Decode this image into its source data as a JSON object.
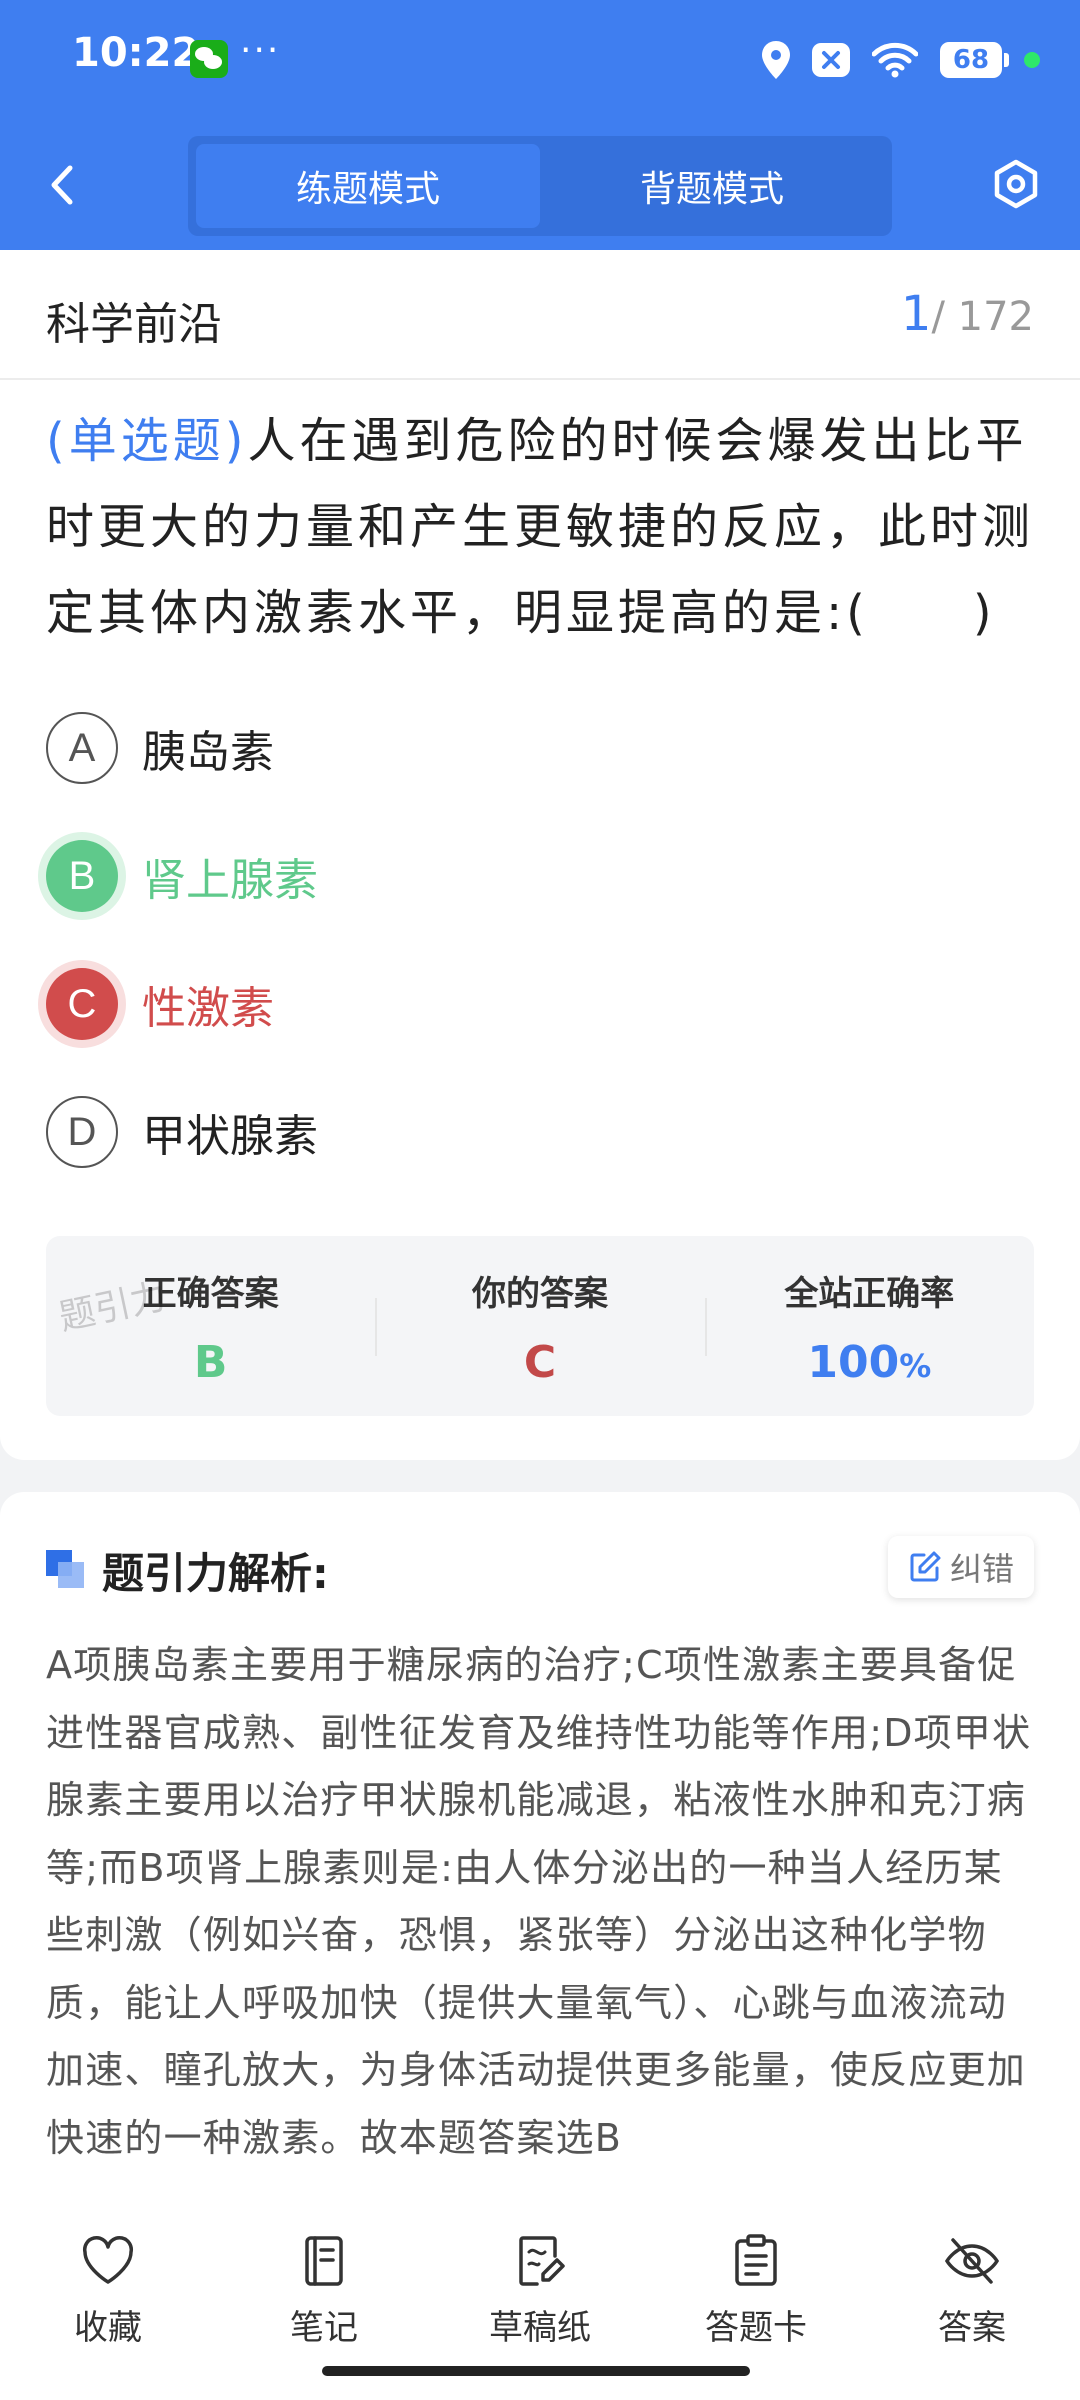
{
  "status": {
    "time": "10:22",
    "more": "···",
    "battery": "68",
    "icons": [
      "wechat-icon",
      "location-icon",
      "close-notification-icon",
      "wifi-icon",
      "battery-icon"
    ]
  },
  "header": {
    "modes": [
      {
        "label": "练题模式",
        "active": true
      },
      {
        "label": "背题模式",
        "active": false
      }
    ],
    "icons": [
      "back-arrow-icon",
      "settings-hex-icon"
    ]
  },
  "subject": {
    "title": "科学前沿",
    "current": "1",
    "total": "/ 172"
  },
  "question": {
    "type": "(单选题)",
    "text": "人在遇到危险的时候会爆发出比平时更大的力量和产生更敏捷的反应，此时测定其体内激素水平，明显提高的是:(　　)"
  },
  "options": [
    {
      "letter": "A",
      "text": "胰岛素",
      "state": "normal"
    },
    {
      "letter": "B",
      "text": "肾上腺素",
      "state": "correct"
    },
    {
      "letter": "C",
      "text": "性激素",
      "state": "wrong"
    },
    {
      "letter": "D",
      "text": "甲状腺素",
      "state": "normal"
    }
  ],
  "answer": {
    "correct_label": "正确答案",
    "correct_value": "B",
    "yours_label": "你的答案",
    "yours_value": "C",
    "rate_label": "全站正确率",
    "rate_value": "100",
    "rate_unit": "%",
    "watermark": "题引力"
  },
  "analysis": {
    "title": "题引力解析:",
    "report_label": "纠错",
    "text": "A项胰岛素主要用于糖尿病的治疗;C项性激素主要具备促进性器官成熟、副性征发育及维持性功能等作用;D项甲状腺素主要用以治疗甲状腺机能减退，粘液性水肿和克汀病等;而B项肾上腺素则是:由人体分泌出的一种当人经历某些刺激（例如兴奋，恐惧，紧张等）分泌出这种化学物质，能让人呼吸加快（提供大量氧气）、心跳与血液流动加速、瞳孔放大，为身体活动提供更多能量，使反应更加快速的一种激素。故本题答案选B"
  },
  "nav": [
    {
      "label": "收藏",
      "icon": "heart-icon"
    },
    {
      "label": "笔记",
      "icon": "notebook-icon"
    },
    {
      "label": "草稿纸",
      "icon": "draft-paper-icon"
    },
    {
      "label": "答题卡",
      "icon": "answer-sheet-icon"
    },
    {
      "label": "答案",
      "icon": "eye-off-icon"
    }
  ],
  "colors": {
    "primary": "#3f7ef0",
    "correct": "#5fc98b",
    "wrong": "#d14c4c"
  }
}
